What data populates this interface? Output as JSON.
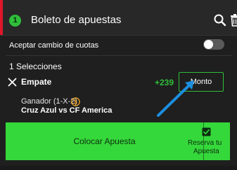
{
  "header": {
    "count": "1",
    "title": "Boleto de apuestas",
    "accent_color": "#e0162b",
    "badge_color": "#2fbf3a",
    "search_icon": "search-icon",
    "trash_icon": "trash-icon"
  },
  "settings": {
    "accept_odds_change_label": "Aceptar cambio de cuotas",
    "accept_odds_change_enabled": false
  },
  "selections": {
    "count_label": "1 Selecciones",
    "items": [
      {
        "name": "Empate",
        "odds": "+239",
        "odds_color": "#2fbf3a",
        "amount_placeholder": "Monto",
        "market": "Ganador (1-X-2)",
        "market_icon": "cash-out-icon",
        "match": "Cruz Azul vs CF America"
      }
    ]
  },
  "actions": {
    "place_bet_label": "Colocar Apuesta",
    "reserve_line1": "Reserva tu",
    "reserve_line2": "Apuesta",
    "reserve_checked": true,
    "button_color": "#35d83a"
  }
}
